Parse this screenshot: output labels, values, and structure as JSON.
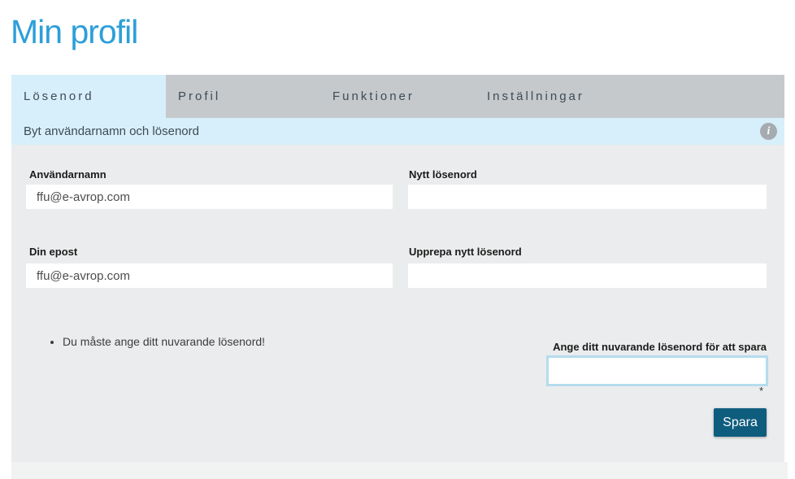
{
  "page": {
    "title": "Min profil"
  },
  "tabs": [
    {
      "label": "Lösenord",
      "active": true
    },
    {
      "label": "Profil",
      "active": false
    },
    {
      "label": "Funktioner",
      "active": false
    },
    {
      "label": "Inställningar",
      "active": false
    }
  ],
  "section_bar": {
    "title": "Byt användarnamn och lösenord",
    "info_icon": "i"
  },
  "form": {
    "username": {
      "label": "Användarnamn",
      "value": "ffu@e-avrop.com"
    },
    "new_password": {
      "label": "Nytt lösenord",
      "value": ""
    },
    "email": {
      "label": "Din epost",
      "value": "ffu@e-avrop.com"
    },
    "repeat_password": {
      "label": "Upprepa nytt lösenord",
      "value": ""
    },
    "validation_messages": [
      "Du måste ange ditt nuvarande lösenord!"
    ],
    "current_password": {
      "label": "Ange ditt nuvarande lösenord för att spara",
      "value": "",
      "required_marker": "*"
    },
    "save_button_label": "Spara"
  },
  "colors": {
    "title_text": "#2c9fd9",
    "tab_active_bg": "#d7effa",
    "tab_inactive_bg": "#c5c9cc",
    "tab_text": "#3e4b55",
    "panel_bg": "#ebeced",
    "save_button_bg": "#0f5d7e",
    "highlight_input_border": "#b5dcee",
    "info_icon_bg": "#a5abaf"
  }
}
